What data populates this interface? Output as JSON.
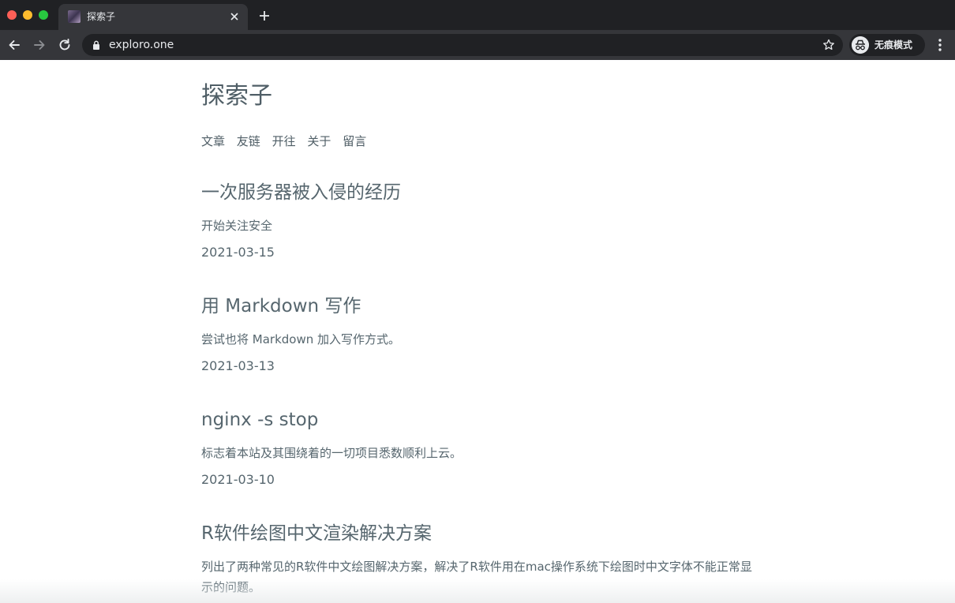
{
  "browser": {
    "tab": {
      "title": "探索子"
    },
    "omnibox": {
      "url": "exploro.one"
    },
    "incognito": {
      "label": "无痕模式"
    },
    "icons": {
      "back": "arrow-left-icon",
      "forward": "arrow-right-icon",
      "reload": "reload-icon",
      "lock": "lock-icon",
      "star": "star-icon",
      "incognito": "incognito-icon",
      "menu": "kebab-menu-icon",
      "close": "close-icon",
      "new_tab": "plus-icon"
    }
  },
  "site": {
    "title": "探索子",
    "nav": [
      {
        "label": "文章"
      },
      {
        "label": "友链"
      },
      {
        "label": "开往"
      },
      {
        "label": "关于"
      },
      {
        "label": "留言"
      }
    ]
  },
  "posts": [
    {
      "title": "一次服务器被入侵的经历",
      "description": "开始关注安全",
      "date": "2021-03-15"
    },
    {
      "title": "用 Markdown 写作",
      "description": "尝试也将 Markdown 加入写作方式。",
      "date": "2021-03-13"
    },
    {
      "title": "nginx -s stop",
      "description": "标志着本站及其围绕着的一切项目悉数顺利上云。",
      "date": "2021-03-10"
    },
    {
      "title": "R软件绘图中文渲染解决方案",
      "description": "列出了两种常见的R软件中文绘图解决方案，解决了R软件用在mac操作系统下绘图时中文字体不能正常显示的问题。",
      "date": ""
    }
  ],
  "colors": {
    "chrome_bg": "#202124",
    "toolbar_bg": "#35363a",
    "text_primary": "#56666e"
  }
}
